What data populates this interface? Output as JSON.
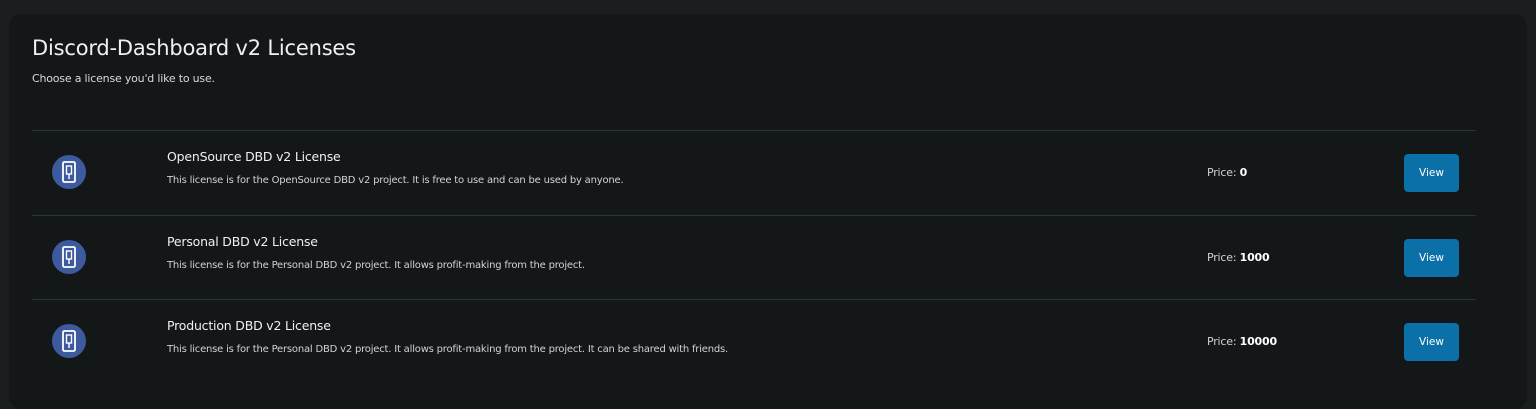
{
  "page": {
    "title": "Discord-Dashboard v2 Licenses",
    "subtitle": "Choose a license you'd like to use."
  },
  "licenses": [
    {
      "name": "OpenSource DBD v2 License",
      "description": "This license is for the OpenSource DBD v2 project. It is free to use and can be used by anyone.",
      "price_label": "Price:",
      "price": "0",
      "button_label": "View",
      "icon": "license-badge-icon"
    },
    {
      "name": "Personal DBD v2 License",
      "description": "This license is for the Personal DBD v2 project. It allows profit-making from the project.",
      "price_label": "Price:",
      "price": "1000",
      "button_label": "View",
      "icon": "license-badge-icon"
    },
    {
      "name": "Production DBD v2 License",
      "description": "This license is for the Personal DBD v2 project. It allows profit-making from the project. It can be shared with friends.",
      "price_label": "Price:",
      "price": "10000",
      "button_label": "View",
      "icon": "license-badge-icon"
    }
  ],
  "colors": {
    "background": "#1a1e1f",
    "card": "#141718",
    "accent_button": "#0b6fa8",
    "icon_circle": "#3e5a9e"
  }
}
